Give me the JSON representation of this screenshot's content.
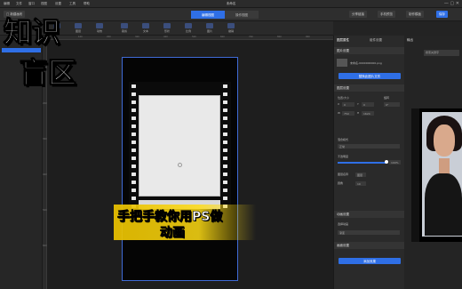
{
  "menu": {
    "items": [
      "编辑",
      "文件",
      "窗口",
      "视图",
      "设置",
      "工具",
      "帮助"
    ],
    "window_title": "未命名"
  },
  "toolbar": {
    "left_button": "□ 新建画布",
    "mode_tabs": [
      "编辑视图",
      "操作视图"
    ],
    "right_buttons": [
      "分享链接",
      "手机预览",
      "制作模板",
      "保存"
    ]
  },
  "subbar": {
    "tools": [
      "素材",
      "图层",
      "动效",
      "裁剪",
      "文本",
      "形状",
      "比例",
      "图片",
      "撤销",
      "变形",
      "恢复",
      "重做",
      "删除",
      "打开"
    ]
  },
  "rulers": {
    "top": [
      "100",
      "200",
      "300",
      "400",
      "500",
      "600",
      "700",
      "800",
      "900",
      "1000"
    ],
    "left": [
      "100",
      "200",
      "300",
      "400",
      "500",
      "600",
      "700"
    ]
  },
  "props": {
    "tabs": [
      "图层属性",
      "组件设置"
    ],
    "section_image": "图片设置",
    "filename": "未命名-0000000000.png",
    "replace_button": "替换此图片文件",
    "section_layout": "图层设置",
    "size_label": "位置/大小",
    "rotate_label": "旋转",
    "x_label": "X",
    "x_value": "0",
    "y_label": "Y",
    "y_value": "0",
    "w_label": "W",
    "w_value": "750",
    "h_label": "H",
    "h_value": "1624",
    "rot_value": "0°",
    "opacity_label": "不透明度",
    "opacity_value": "100%",
    "blend_label": "混合模式",
    "blend_value": "正常",
    "layer_name_label": "图层名称",
    "layer_name_value": "图层",
    "radius_label": "圆角",
    "radius_value": "10",
    "section_anim": "动画设置",
    "anim_label": "选择动画",
    "anim_value": "渐变",
    "section_effect": "画面设置",
    "add_button": "添加效果"
  },
  "farright": {
    "title": "输出",
    "search_placeholder": "搜索关键字"
  },
  "overlay": {
    "watermark_line1": "知识",
    "watermark_line2": "盲区",
    "caption_line1": "手把手教你用PS做",
    "caption_line2": "动画"
  },
  "colors": {
    "accent": "#2f6fe6",
    "selection": "#3f6bd6",
    "banner": "#f0c400"
  }
}
